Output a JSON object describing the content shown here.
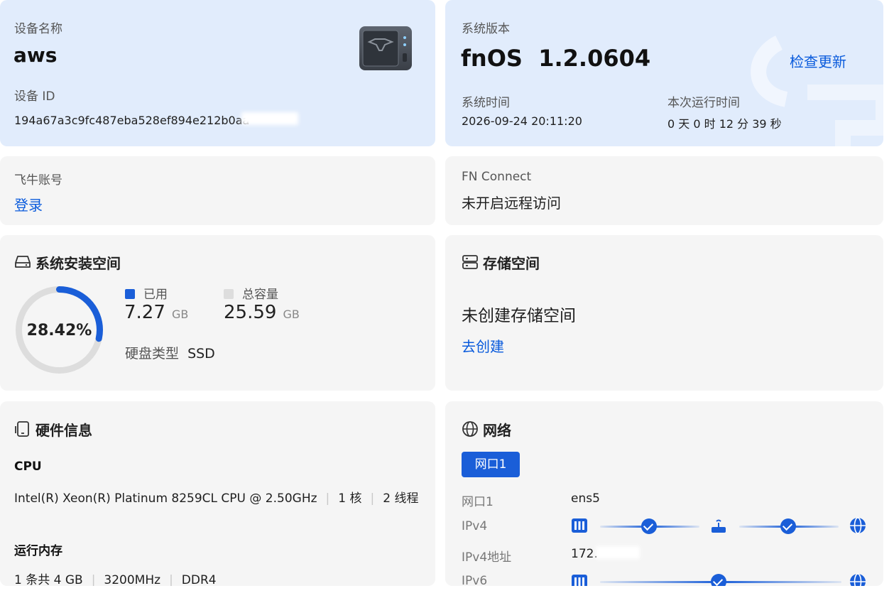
{
  "device": {
    "name_label": "设备名称",
    "name": "aws",
    "id_label": "设备 ID",
    "id": "194a67a3c9fc487eba528ef894e212b0aa"
  },
  "system": {
    "version_label": "系统版本",
    "version": "fnOS  1.2.0604",
    "check_update": "检查更新",
    "time_label": "系统时间",
    "time": "2026-09-24 20:11:20",
    "uptime_label": "本次运行时间",
    "uptime": "0 天 0 时 12 分 39 秒"
  },
  "account": {
    "label": "飞牛账号",
    "login": "登录"
  },
  "fn_connect": {
    "label": "FN Connect",
    "status": "未开启远程访问"
  },
  "system_space": {
    "title": "系统安装空间",
    "percent_text": "28.42%",
    "used_fraction": 0.2842,
    "used_label": "已用",
    "used_value": "7.27",
    "used_unit": "GB",
    "total_label": "总容量",
    "total_value": "25.59",
    "total_unit": "GB",
    "disk_type_label": "硬盘类型",
    "disk_type": "SSD",
    "used_color": "#1a5ed8",
    "total_color": "#dddddd"
  },
  "storage": {
    "title": "存储空间",
    "empty_text": "未创建存储空间",
    "create_link": "去创建"
  },
  "hardware": {
    "title": "硬件信息",
    "cpu_label": "CPU",
    "cpu_model": "Intel(R) Xeon(R) Platinum 8259CL CPU @ 2.50GHz",
    "cpu_cores": "1 核",
    "cpu_threads": "2 线程",
    "mem_label": "运行内存",
    "mem_count": "1 条共 4 GB",
    "mem_freq": "3200MHz",
    "mem_type": "DDR4"
  },
  "network": {
    "title": "网络",
    "tab": "网口1",
    "rows": {
      "port_label": "网口1",
      "port_value": "ens5",
      "ipv4_label": "IPv4",
      "ipv4_addr_label": "IPv4地址",
      "ipv4_addr": "172.",
      "ipv6_label": "IPv6"
    }
  },
  "colors": {
    "accent": "#1a5ed8",
    "card_blue": "#e1ecfc",
    "card_gray": "#f5f5f5"
  }
}
